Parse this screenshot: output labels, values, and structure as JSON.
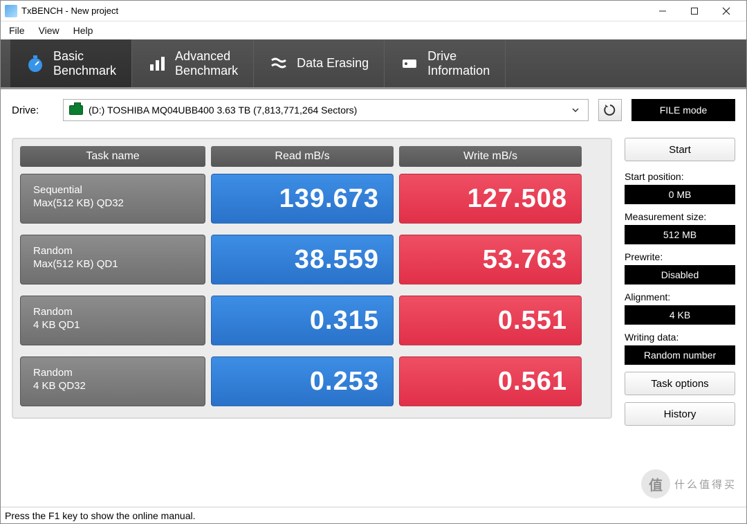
{
  "window": {
    "title": "TxBENCH - New project"
  },
  "menu": {
    "file": "File",
    "view": "View",
    "help": "Help"
  },
  "tabs": {
    "basic": {
      "l1": "Basic",
      "l2": "Benchmark"
    },
    "advanced": {
      "l1": "Advanced",
      "l2": "Benchmark"
    },
    "erase": {
      "l1": "Data Erasing"
    },
    "drive": {
      "l1": "Drive",
      "l2": "Information"
    }
  },
  "drive": {
    "label": "Drive:",
    "value": "(D:) TOSHIBA MQ04UBB400  3.63 TB (7,813,771,264 Sectors)"
  },
  "filemode": "FILE mode",
  "headers": {
    "task": "Task name",
    "read": "Read mB/s",
    "write": "Write mB/s"
  },
  "rows": [
    {
      "name_l1": "Sequential",
      "name_l2": "Max(512 KB) QD32",
      "read": "139.673",
      "write": "127.508"
    },
    {
      "name_l1": "Random",
      "name_l2": "Max(512 KB) QD1",
      "read": "38.559",
      "write": "53.763"
    },
    {
      "name_l1": "Random",
      "name_l2": "4 KB QD1",
      "read": "0.315",
      "write": "0.551"
    },
    {
      "name_l1": "Random",
      "name_l2": "4 KB QD32",
      "read": "0.253",
      "write": "0.561"
    }
  ],
  "side": {
    "start": "Start",
    "startpos_label": "Start position:",
    "startpos_val": "0 MB",
    "measure_label": "Measurement size:",
    "measure_val": "512 MB",
    "prewrite_label": "Prewrite:",
    "prewrite_val": "Disabled",
    "align_label": "Alignment:",
    "align_val": "4 KB",
    "writedata_label": "Writing data:",
    "writedata_val": "Random number",
    "taskopts": "Task options",
    "history": "History"
  },
  "status": "Press the F1 key to show the online manual.",
  "watermark": {
    "badge": "值",
    "text": "什么值得买"
  }
}
